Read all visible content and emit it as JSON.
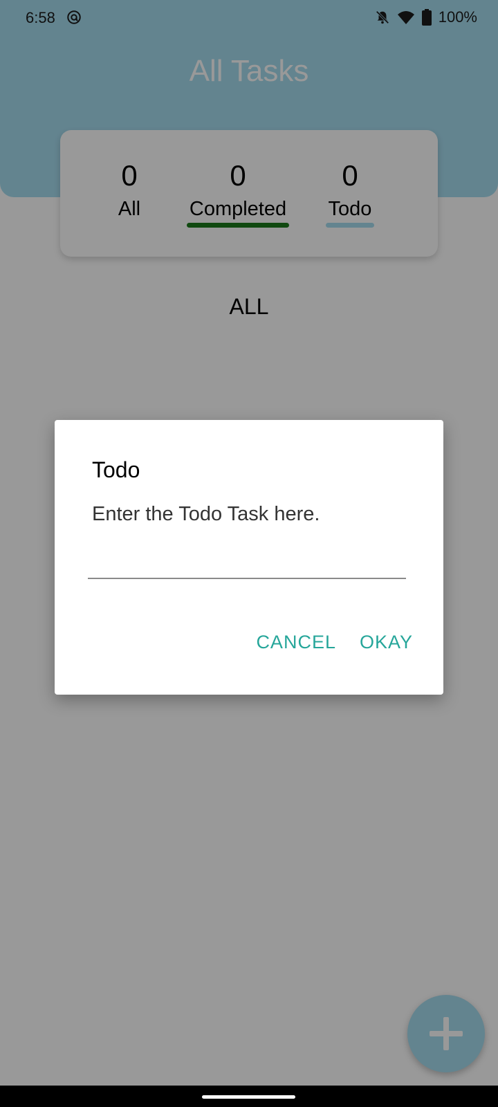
{
  "status_bar": {
    "time": "6:58",
    "battery": "100%",
    "icons": [
      "at-sign-icon",
      "bell-off-icon",
      "wifi-icon",
      "battery-icon"
    ]
  },
  "app": {
    "title": "All Tasks",
    "header_color": "#a6dcef",
    "stats": {
      "all": {
        "count": "0",
        "label": "All"
      },
      "completed": {
        "count": "0",
        "label": "Completed",
        "color": "#1b7a1b"
      },
      "todo": {
        "count": "0",
        "label": "Todo",
        "color": "#a6dcef"
      }
    },
    "filter": "ALL",
    "fab_icon": "plus-icon"
  },
  "dialog": {
    "title": "Todo",
    "message": "Enter the Todo Task here.",
    "input_value": "",
    "cancel_label": "CANCEL",
    "okay_label": "OKAY",
    "accent_color": "#26a69a"
  }
}
